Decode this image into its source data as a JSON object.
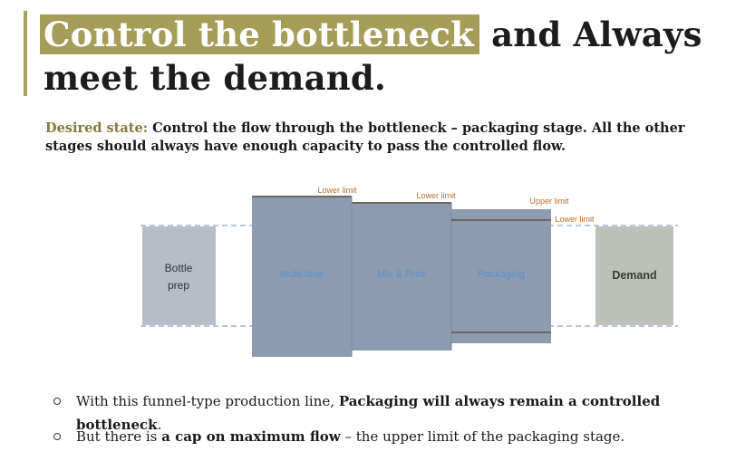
{
  "title": {
    "highlight": "Control the bottleneck",
    "rest": " and Always meet the demand."
  },
  "desired_state": {
    "label": "Desired state:",
    "text": " Control the flow through the bottleneck – packaging stage.  All the other stages should always have enough capacity to pass the controlled flow."
  },
  "diagram": {
    "stages": [
      {
        "id": "bottle_prep",
        "label_line1": "Bottle",
        "label_line2": "prep"
      },
      {
        "id": "multi_lane",
        "label": "Multi-lane",
        "limit_label": "Lower limit"
      },
      {
        "id": "mix_print",
        "label": "Mix & Print",
        "limit_label": "Lower limit"
      },
      {
        "id": "packaging",
        "label": "Packaging",
        "upper_limit_label": "Upper limit",
        "lower_limit_label": "Lower limit"
      },
      {
        "id": "demand",
        "label": "Demand"
      }
    ],
    "colors": {
      "bottle_prep": "#b8bcc6",
      "stage": "#8c9bb0",
      "stage_text": "#5b8fd0",
      "stage_line": "#6f6560",
      "demand": "#bdc0b8",
      "limit_label": "#b8702e",
      "dashed": "#8fa6c4"
    }
  },
  "bullets": [
    {
      "pre": "With this funnel-type production line, ",
      "bold": "Packaging will always remain a controlled bottleneck",
      "post": "."
    },
    {
      "pre": "But there is ",
      "bold": "a cap on maximum flow",
      "post": " – the upper limit of the packaging stage."
    }
  ]
}
